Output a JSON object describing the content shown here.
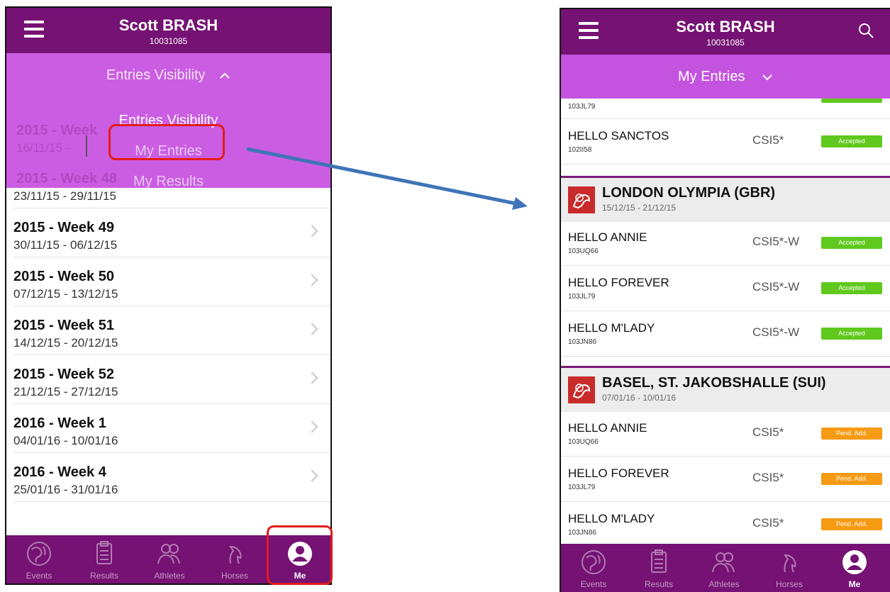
{
  "left": {
    "header": {
      "name": "Scott BRASH",
      "id": "10031085"
    },
    "dropdown": {
      "header": "Entries Visibility",
      "items": [
        "Entries Visibility",
        "My Entries",
        "My Results"
      ]
    },
    "ghost": {
      "week": "2015 - Week",
      "dates": "16/11/15 -",
      "week2": "2015 - Week 48"
    },
    "first_row_dates": "23/11/15 - 29/11/15",
    "weeks": [
      {
        "title": "2015 - Week 49",
        "dates": "30/11/15 - 06/12/15"
      },
      {
        "title": "2015 - Week 50",
        "dates": "07/12/15 - 13/12/15"
      },
      {
        "title": "2015 - Week 51",
        "dates": "14/12/15 - 20/12/15"
      },
      {
        "title": "2015 - Week 52",
        "dates": "21/12/15 - 27/12/15"
      },
      {
        "title": "2016 - Week 1",
        "dates": "04/01/16 - 10/01/16"
      },
      {
        "title": "2016 - Week 4",
        "dates": "25/01/16 - 31/01/16"
      }
    ],
    "tabs": [
      "Events",
      "Results",
      "Athletes",
      "Horses",
      "Me"
    ]
  },
  "right": {
    "header": {
      "name": "Scott BRASH",
      "id": "10031085"
    },
    "subheader": "My Entries",
    "top_partial_id": "103JL79",
    "top_entry": {
      "name": "HELLO SANCTOS",
      "id": "102II58",
      "class": "CSI5*",
      "status": "Accepted"
    },
    "events": [
      {
        "name": "LONDON OLYMPIA (GBR)",
        "dates": "15/12/15 - 21/12/15",
        "entries": [
          {
            "name": "HELLO ANNIE",
            "id": "103UQ66",
            "class": "CSI5*-W",
            "status": "Accepted"
          },
          {
            "name": "HELLO FOREVER",
            "id": "103JL79",
            "class": "CSI5*-W",
            "status": "Accepted"
          },
          {
            "name": "HELLO M'LADY",
            "id": "103JN86",
            "class": "CSI5*-W",
            "status": "Accepted"
          }
        ]
      },
      {
        "name": "BASEL, ST. JAKOBSHALLE (SUI)",
        "dates": "07/01/16 - 10/01/16",
        "entries": [
          {
            "name": "HELLO ANNIE",
            "id": "103UQ66",
            "class": "CSI5*",
            "status": "Pend. Add."
          },
          {
            "name": "HELLO FOREVER",
            "id": "103JL79",
            "class": "CSI5*",
            "status": "Pend. Add."
          },
          {
            "name": "HELLO M'LADY",
            "id": "103JN86",
            "class": "CSI5*",
            "status": "Pend. Add."
          }
        ]
      }
    ],
    "tabs": [
      "Events",
      "Results",
      "Athletes",
      "Horses",
      "Me"
    ]
  },
  "colors": {
    "brand_purple": "#751273",
    "dropdown_purple": "#c454e0",
    "accepted_green": "#5fc91d",
    "pending_orange": "#f79a14",
    "highlight_red": "#e41b1b",
    "arrow_blue": "#3f74b8"
  },
  "icons": {
    "events": "globe-icon",
    "results": "clipboard-icon",
    "athletes": "people-icon",
    "horses": "horse-head-icon",
    "me": "person-circle-icon",
    "menu": "hamburger-icon",
    "search": "search-icon"
  }
}
